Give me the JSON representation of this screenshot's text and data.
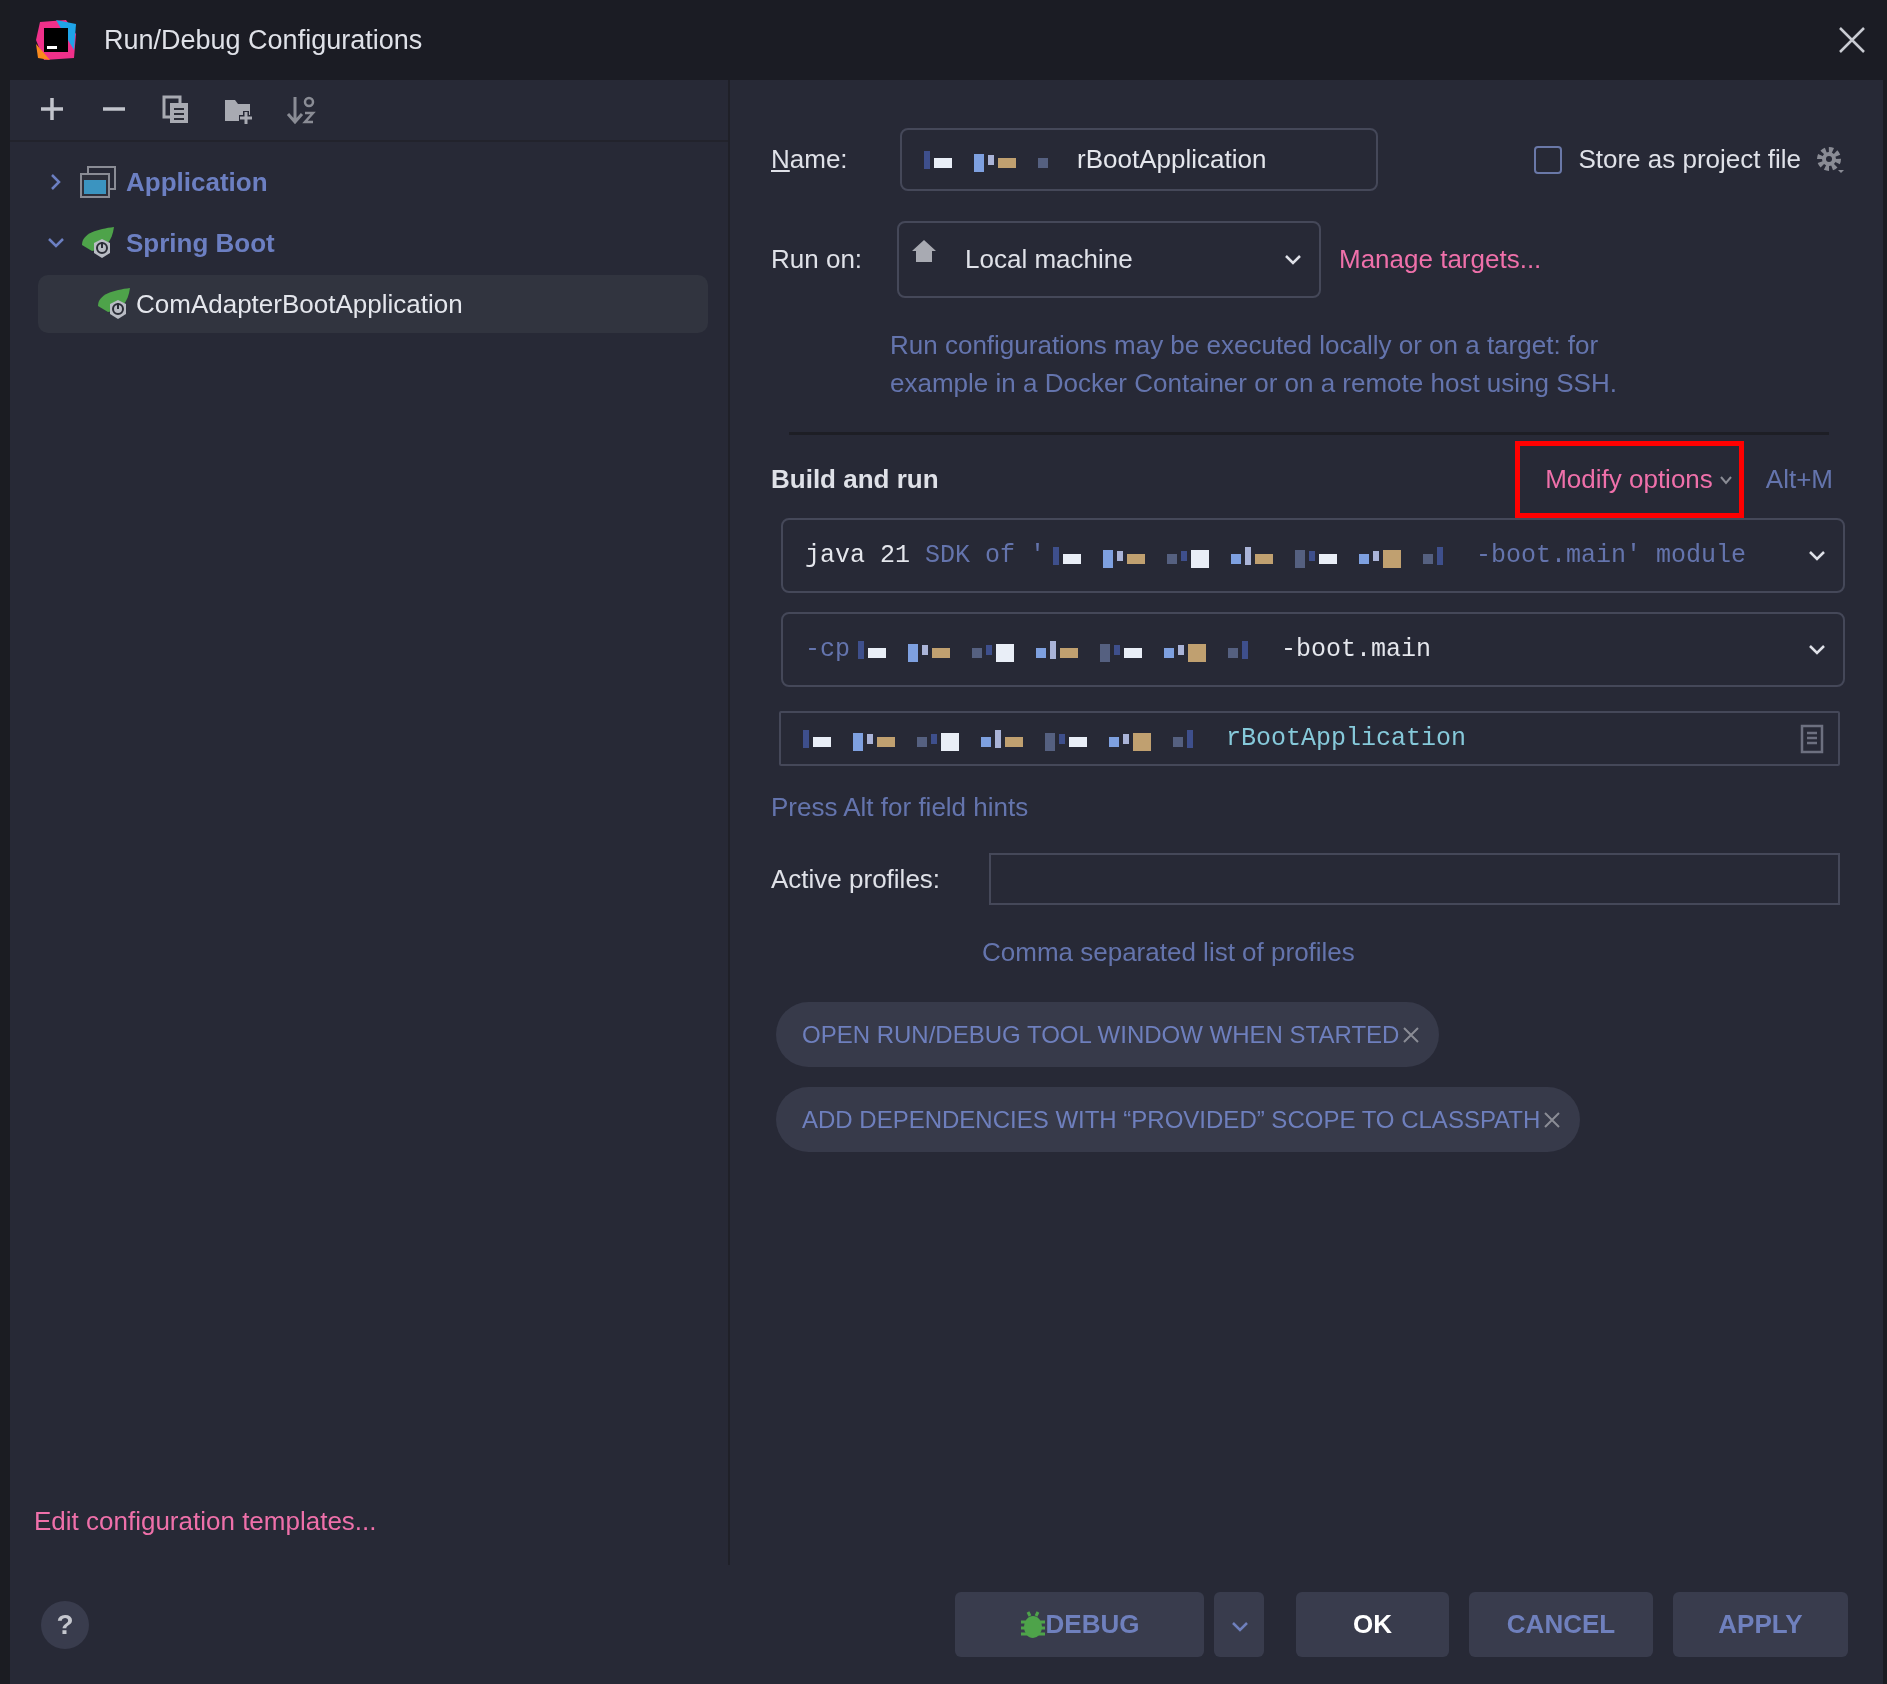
{
  "window": {
    "title": "Run/Debug Configurations"
  },
  "toolbar": [
    {
      "kind": "add"
    },
    {
      "kind": "remove"
    },
    {
      "kind": "copy"
    },
    {
      "kind": "folder"
    },
    {
      "kind": "sort"
    }
  ],
  "tree": [
    {
      "label": "Application",
      "kind": "application",
      "expanded": false,
      "selected": false
    },
    {
      "label": "Spring Boot",
      "kind": "spring",
      "expanded": true,
      "selected": false,
      "children": [
        {
          "label": "ComAdapterBootApplication",
          "kind": "spring",
          "selected": true
        }
      ]
    }
  ],
  "templates_link": "Edit configuration templates...",
  "name": {
    "label": "Name:",
    "mnemonic": true,
    "segments": [
      {
        "kind": "redacted"
      },
      {
        "kind": "value",
        "text": "rBootApplication"
      }
    ]
  },
  "store_as_project_file": {
    "label": "Store as project file",
    "checked": false
  },
  "run_on": {
    "label": "Run on:",
    "value": "Local machine",
    "link": "Manage targets...",
    "hint": "Run configurations may be executed locally or on a target: for example in a Docker Container or on a remote host using SSH."
  },
  "build_and_run": {
    "title": "Build and run",
    "modify_options": {
      "label": "Modify options",
      "highlighted": true
    },
    "shortcut": "Alt+M",
    "fields": [
      {
        "kind": "dropdown",
        "segments": [
          {
            "kind": "value",
            "text": "java 21"
          },
          {
            "kind": "hint",
            "text": "SDK of '"
          },
          {
            "kind": "redacted"
          },
          {
            "kind": "hint",
            "text": "-boot.main' module"
          }
        ]
      },
      {
        "kind": "dropdown",
        "segments": [
          {
            "kind": "hint",
            "text": "-cp"
          },
          {
            "kind": "redacted"
          },
          {
            "kind": "value",
            "text": "-boot.main"
          }
        ]
      },
      {
        "kind": "browse",
        "segments": [
          {
            "kind": "redacted"
          },
          {
            "kind": "class",
            "text": "rBootApplication"
          }
        ]
      }
    ]
  },
  "field_hint": "Press Alt for field hints",
  "active_profiles": {
    "label": "Active profiles:",
    "hint": "Comma separated list of profiles"
  },
  "options": [
    {
      "label": "OPEN RUN/DEBUG TOOL WINDOW WHEN STARTED"
    },
    {
      "label": "ADD DEPENDENCIES WITH “PROVIDED” SCOPE TO CLASSPATH"
    }
  ],
  "footer": {
    "help": "?",
    "buttons": [
      {
        "kind": "debug",
        "label": "DEBUG"
      },
      {
        "kind": "menu"
      },
      {
        "kind": "default",
        "label": "OK"
      },
      {
        "kind": "normal",
        "label": "CANCEL"
      },
      {
        "kind": "normal",
        "label": "APPLY"
      }
    ]
  }
}
